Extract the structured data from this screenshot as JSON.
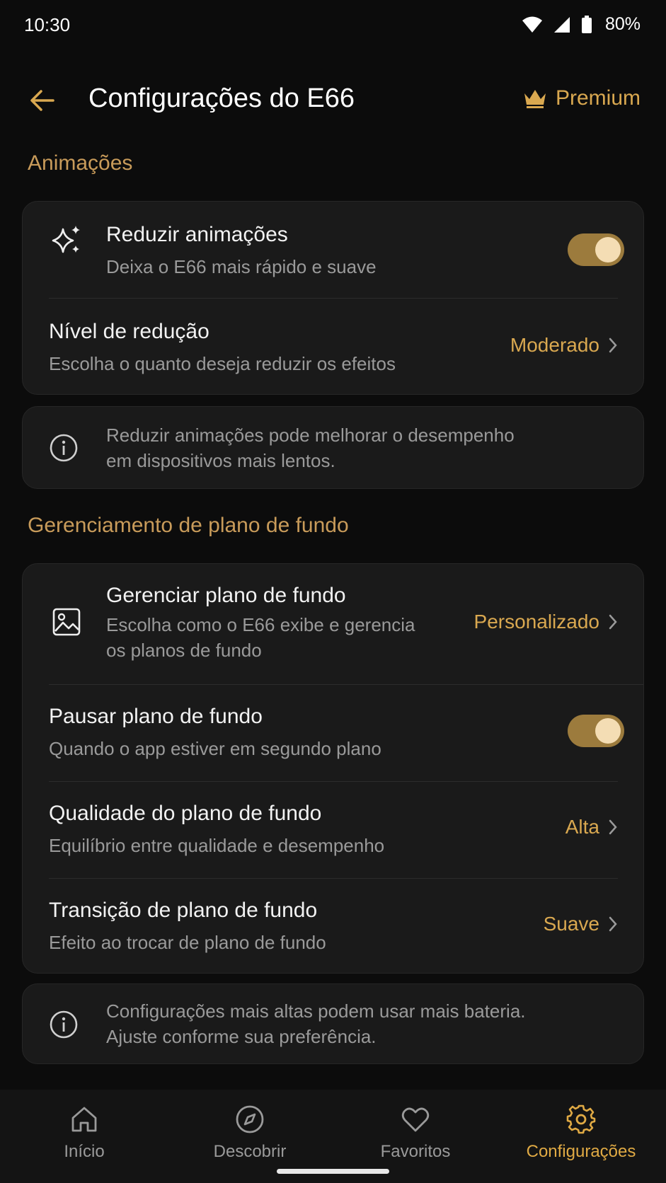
{
  "status": {
    "time": "10:30",
    "battery": "80%"
  },
  "header": {
    "title": "Configurações do E66",
    "premium_label": "Premium"
  },
  "animations": {
    "section_title": "Animações",
    "reduce": {
      "title": "Reduzir animações",
      "subtitle": "Deixa o E66 mais rápido e suave",
      "enabled": true
    },
    "level": {
      "title": "Nível de redução",
      "subtitle": "Escolha o quanto deseja reduzir os efeitos",
      "value": "Moderado"
    },
    "info": {
      "line1": "Reduzir animações pode melhorar o desempenho",
      "line2": "em dispositivos mais lentos."
    }
  },
  "background": {
    "section_title": "Gerenciamento de plano de fundo",
    "manage": {
      "title": "Gerenciar plano de fundo",
      "subtitle_line1": "Escolha como o E66 exibe e gerencia",
      "subtitle_line2": "os planos de fundo",
      "value": "Personalizado"
    },
    "pause": {
      "title": "Pausar plano de fundo",
      "subtitle": "Quando o app estiver em segundo plano",
      "enabled": true
    },
    "quality": {
      "title": "Qualidade do plano de fundo",
      "subtitle": "Equilíbrio entre qualidade e desempenho",
      "value": "Alta"
    },
    "transition": {
      "title": "Transição de plano de fundo",
      "subtitle": "Efeito ao trocar de plano de fundo",
      "value": "Suave"
    },
    "info": {
      "line1": "Configurações mais altas podem usar mais bateria.",
      "line2": "Ajuste conforme sua preferência."
    }
  },
  "nav": {
    "items": [
      {
        "label": "Início",
        "icon": "home-icon",
        "active": false
      },
      {
        "label": "Descobrir",
        "icon": "compass-icon",
        "active": false
      },
      {
        "label": "Favoritos",
        "icon": "heart-icon",
        "active": false
      },
      {
        "label": "Configurações",
        "icon": "gear-icon",
        "active": true
      }
    ]
  },
  "colors": {
    "accent": "#d9a850",
    "background": "#0c0c0c",
    "card": "#1a1a1a",
    "toggle_track": "#9c7b3d",
    "toggle_knob": "#f4ddb4"
  }
}
